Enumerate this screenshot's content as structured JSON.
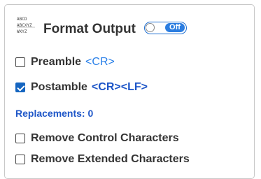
{
  "header": {
    "title": "Format Output",
    "icon": "format-text-icon",
    "toggle": {
      "label": "Off",
      "state": false
    }
  },
  "options": {
    "preamble": {
      "label": "Preamble",
      "value": "<CR>",
      "checked": false
    },
    "postamble": {
      "label": "Postamble",
      "value": "<CR><LF>",
      "checked": true
    }
  },
  "replacements": {
    "text": "Replacements: 0"
  },
  "remove_options": {
    "control": {
      "label": "Remove Control Characters",
      "checked": false
    },
    "extended": {
      "label": "Remove Extended Characters",
      "checked": false
    }
  },
  "colors": {
    "accent": "#2b7de0",
    "link": "#1f57c8",
    "checkbox": "#1565c0"
  }
}
